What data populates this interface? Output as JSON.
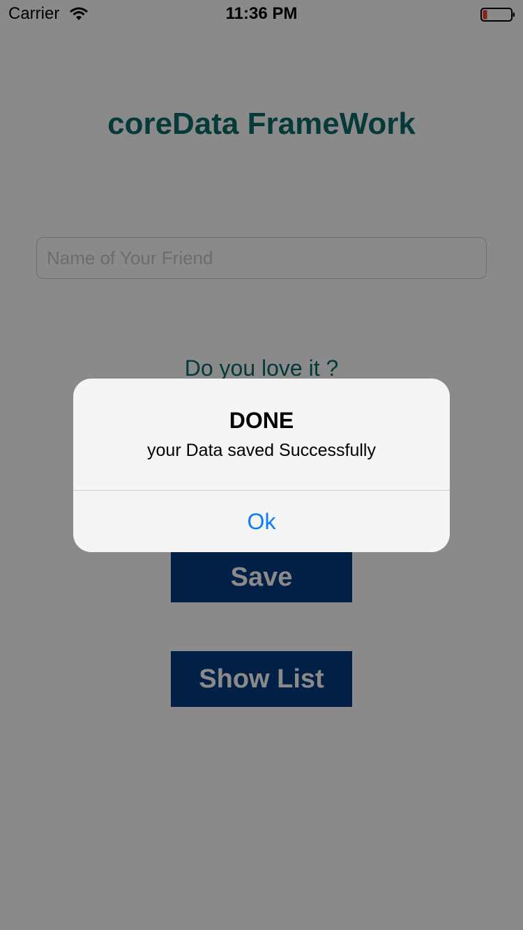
{
  "status_bar": {
    "carrier": "Carrier",
    "time": "11:36 PM",
    "icons": [
      "wifi-icon",
      "battery-icon"
    ],
    "battery_color": "#ff3b30"
  },
  "main": {
    "title": "coreData FrameWork",
    "name_input": {
      "placeholder": "Name of Your Friend",
      "value": ""
    },
    "question": "Do you love it ?",
    "save_label": "Save",
    "show_list_label": "Show List"
  },
  "alert": {
    "title": "DONE",
    "message": "your Data saved Successfully",
    "ok_label": "Ok"
  },
  "colors": {
    "title_teal": "#0c6b68",
    "button_blue": "#043a80",
    "ios_blue": "#0a7aff"
  }
}
